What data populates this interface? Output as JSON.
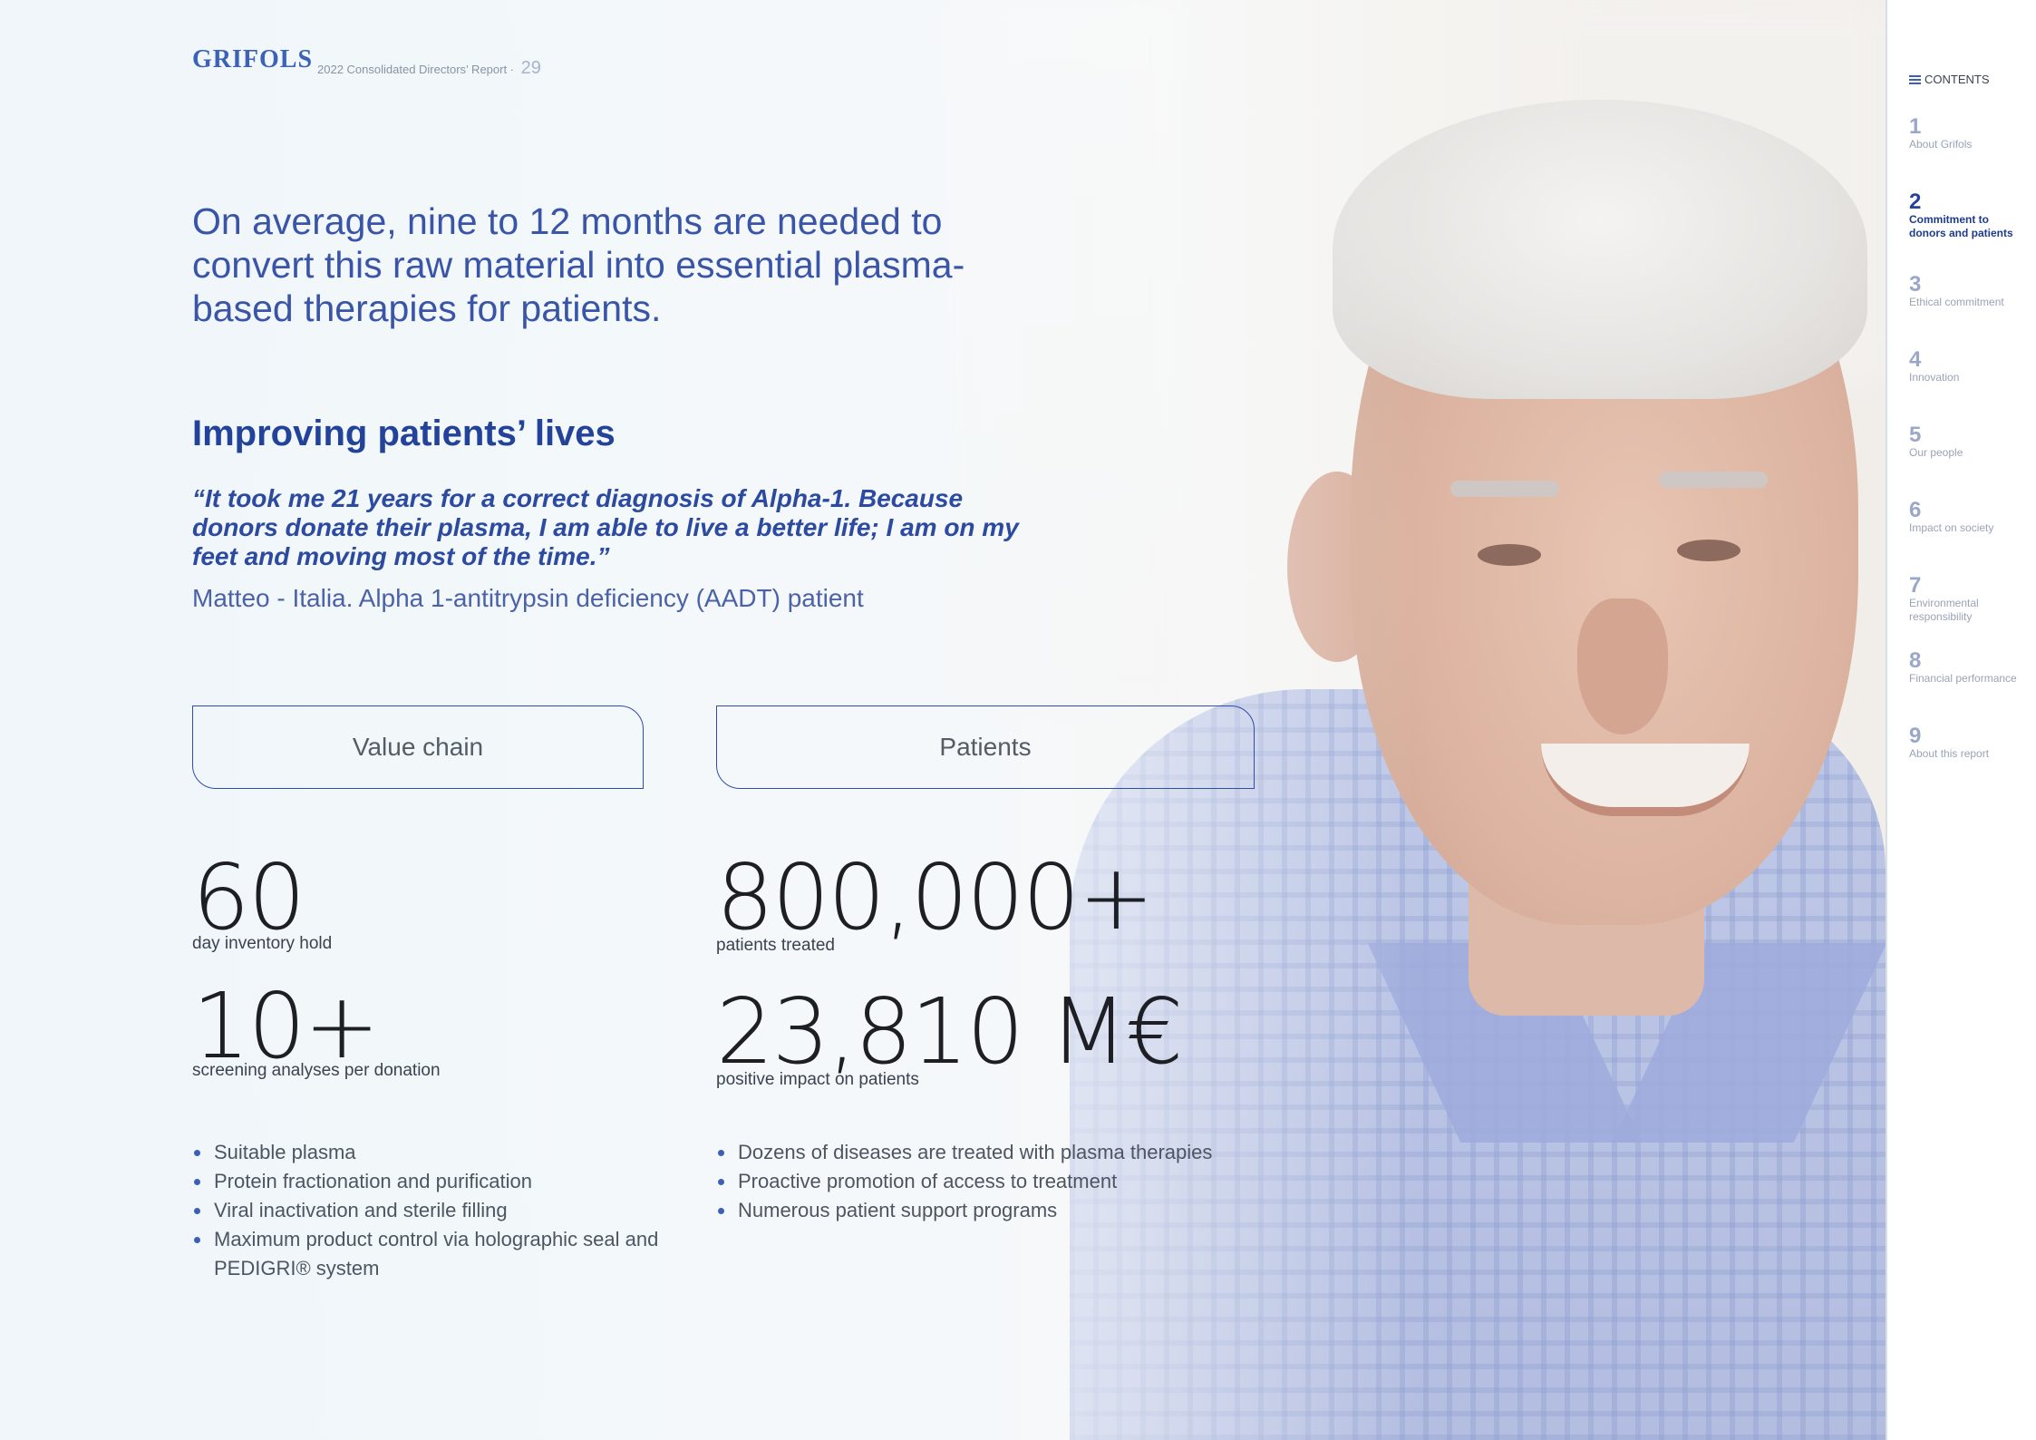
{
  "header": {
    "logo": "GRIFOLS",
    "report_title": "2022 Consolidated Directors’ Report ·",
    "page_number": "29"
  },
  "intro": "On average, nine to 12 months are needed to convert this raw material into essential plasma-based therapies for patients.",
  "section": {
    "heading": "Improving patients’ lives",
    "quote": "“It took me 21 years for a correct diagnosis of Alpha-1. Because donors donate their plasma, I am able to live a better life; I am on my feet and moving most of the time.”",
    "attribution": "Matteo - Italia. Alpha 1-antitrypsin deficiency (AADT) patient"
  },
  "tabs": {
    "value_chain": "Value chain",
    "patients": "Patients"
  },
  "value_chain": {
    "stats": [
      {
        "value": "60",
        "label": "day inventory hold"
      },
      {
        "value": "10+",
        "label": "screening analyses per donation"
      }
    ],
    "bullets": [
      "Suitable plasma",
      "Protein fractionation and purification",
      "Viral inactivation and sterile filling",
      "Maximum product control via holographic seal and PEDIGRI® system"
    ]
  },
  "patients": {
    "stats": [
      {
        "value": "800,000+",
        "label": "patients treated"
      },
      {
        "value": "23,810 M€",
        "label": "positive impact on patients"
      }
    ],
    "bullets": [
      "Dozens of diseases are treated with plasma therapies",
      "Proactive promotion of access to treatment",
      "Numerous patient support programs"
    ]
  },
  "sidebar": {
    "contents_label": "CONTENTS",
    "items": [
      {
        "num": "1",
        "label": "About Grifols"
      },
      {
        "num": "2",
        "label": "Commitment to donors and patients",
        "active": true
      },
      {
        "num": "3",
        "label": "Ethical commitment"
      },
      {
        "num": "4",
        "label": "Innovation"
      },
      {
        "num": "5",
        "label": "Our people"
      },
      {
        "num": "6",
        "label": "Impact on society"
      },
      {
        "num": "7",
        "label": "Environmental responsibility"
      },
      {
        "num": "8",
        "label": "Financial performance"
      },
      {
        "num": "9",
        "label": "About this report"
      }
    ]
  },
  "colors": {
    "brand_blue": "#23429a",
    "accent_blue": "#3d5fb4",
    "muted_text": "#9aa3b5"
  }
}
